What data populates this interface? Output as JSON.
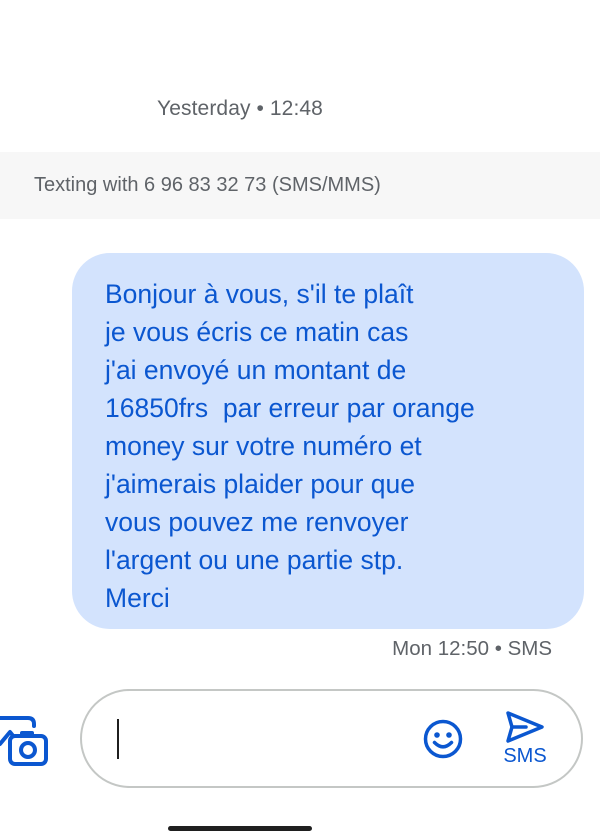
{
  "conversation": {
    "date_header": "Yesterday • 12:48",
    "texting_banner": "Texting with 6 96 83 32 73 (SMS/MMS)"
  },
  "messages": [
    {
      "direction": "outgoing",
      "text": "Bonjour à vous, s'il te plaît\nje vous écris ce matin cas\nj'ai envoyé un montant de\n16850frs  par erreur par orange\nmoney sur votre numéro et\nj'aimerais plaider pour que\nvous pouvez me renvoyer\nl'argent ou une partie stp.\nMerci",
      "meta": "Mon 12:50 • SMS"
    }
  ],
  "compose": {
    "value": "",
    "send_label": "SMS",
    "attach_icon": "gallery-camera-icon",
    "emoji_icon": "emoji-smile-icon",
    "send_icon": "send-arrow-icon"
  },
  "colors": {
    "bubble_bg": "#d3e3fd",
    "bubble_text": "#0b57d0",
    "accent": "#0b57d0",
    "secondary_text": "#5f6368"
  }
}
